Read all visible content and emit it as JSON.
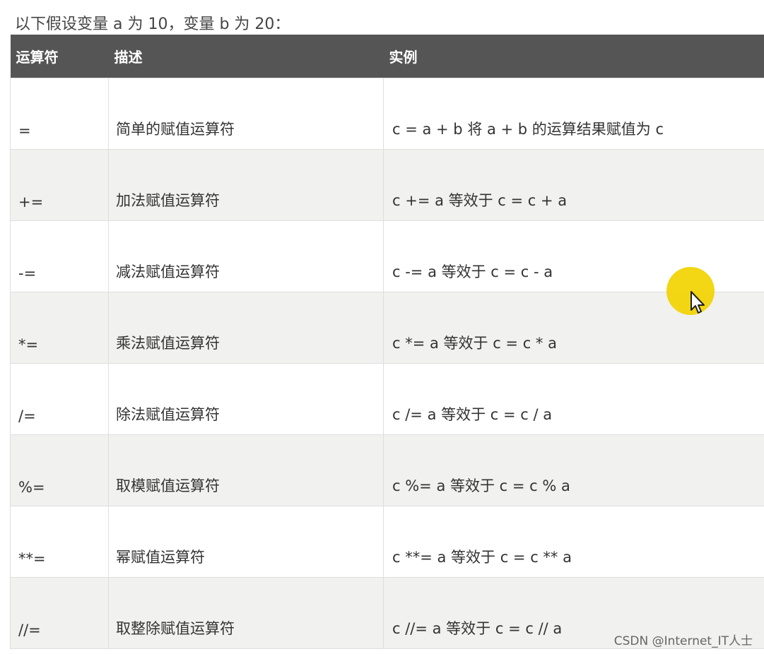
{
  "intro": "以下假设变量 a 为 10，变量 b 为 20：",
  "table": {
    "headers": [
      "运算符",
      "描述",
      "实例"
    ],
    "rows": [
      {
        "operator": "=",
        "description": "简单的赋值运算符",
        "example": "c = a + b  将  a + b  的运算结果赋值为  c"
      },
      {
        "operator": "+=",
        "description": "加法赋值运算符",
        "example": "c += a  等效于  c = c + a"
      },
      {
        "operator": "-=",
        "description": "减法赋值运算符",
        "example": "c -= a  等效于  c = c - a"
      },
      {
        "operator": "*=",
        "description": "乘法赋值运算符",
        "example": "c *= a  等效于  c = c * a"
      },
      {
        "operator": "/=",
        "description": "除法赋值运算符",
        "example": "c /= a  等效于  c = c / a"
      },
      {
        "operator": "%=",
        "description": "取模赋值运算符",
        "example": "c %= a  等效于  c = c % a"
      },
      {
        "operator": "**=",
        "description": "幂赋值运算符",
        "example": "c **= a  等效于  c = c ** a"
      },
      {
        "operator": "//=",
        "description": "取整除赋值运算符",
        "example": "c //= a  等效于  c = c // a"
      }
    ]
  },
  "watermark": "CSDN @Internet_IT人士",
  "colors": {
    "header_bg": "#555555",
    "header_text": "#ffffff",
    "row_alt_bg": "#f1f1ef",
    "cursor_highlight": "#f2d300"
  },
  "icons": {
    "cursor": "mouse-pointer-icon"
  }
}
